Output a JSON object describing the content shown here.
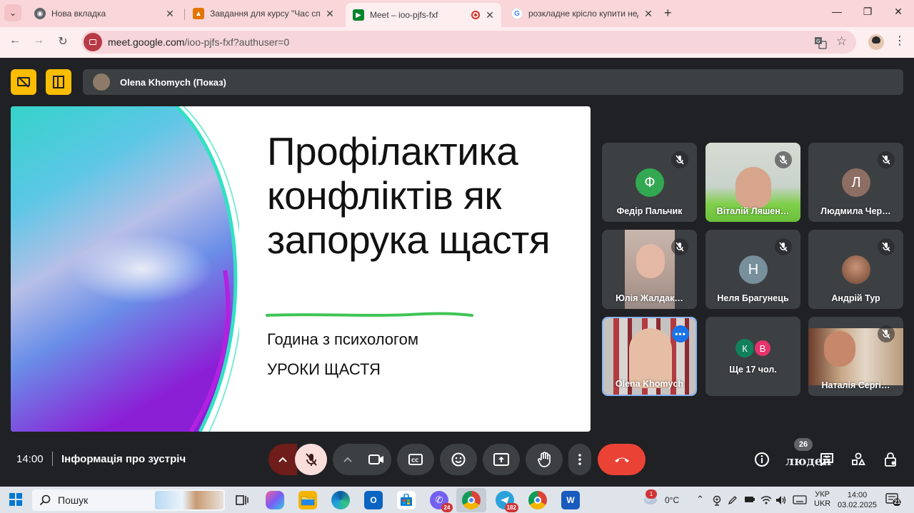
{
  "browser": {
    "tabs": [
      {
        "title": "Нова вкладка",
        "active": false
      },
      {
        "title": "Завдання для курсу \"Час спілк",
        "active": false
      },
      {
        "title": "Meet – ioo-pjfs-fxf",
        "active": true,
        "recording": true
      },
      {
        "title": "розкладне крісло купити недо",
        "active": false
      }
    ],
    "url_host": "meet.google.com",
    "url_path": "/ioo-pjfs-fxf?authuser=0"
  },
  "meet": {
    "presenter_label": "Olena Khomych (Показ)",
    "slide": {
      "title": "Профілактика конфліктів як запорука щастя",
      "subtitle1": "Година з психологом",
      "subtitle2": "УРОКИ ЩАСТЯ"
    },
    "participants": [
      {
        "name": "Федір Пальчик",
        "initial": "Ф",
        "avatar_color": "#33a852",
        "muted": true
      },
      {
        "name": "Віталій Ляшен…",
        "muted": true,
        "video": true
      },
      {
        "name": "Людмила Чер…",
        "initial": "Л",
        "avatar_color": "#8d6e63",
        "muted": true
      },
      {
        "name": "Юлія Жалдак…",
        "muted": true,
        "video": true
      },
      {
        "name": "Неля Брагунець",
        "initial": "Н",
        "avatar_color": "#78909c",
        "muted": true
      },
      {
        "name": "Андрій Тур",
        "muted": true,
        "video": true
      },
      {
        "name": "Olena Khomych",
        "self": true,
        "video": true
      },
      {
        "name": "Ще 17 чол.",
        "initials": [
          "К",
          "В"
        ],
        "initial_colors": [
          "#12805c",
          "#e8336d"
        ]
      },
      {
        "name": "Наталія Сергі…",
        "muted": true,
        "video": true
      }
    ],
    "time": "14:00",
    "meeting_info": "Інформація про зустріч",
    "people_count": "26",
    "people_label": "людей"
  },
  "taskbar": {
    "search_placeholder": "Пошук",
    "viber_badge": "24",
    "telegram_badge": "182",
    "weather_temp": "0°C",
    "weather_alert": "1",
    "lang_line1": "УКР",
    "lang_line2": "UKR",
    "clock_time": "14:00",
    "clock_date": "03.02.2025",
    "notification_count": "21"
  }
}
